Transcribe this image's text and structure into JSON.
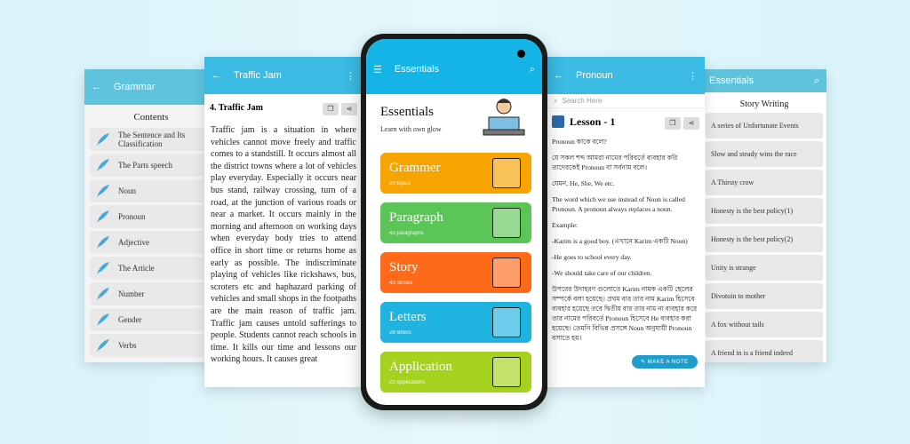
{
  "grammar_screen": {
    "title": "Grammar",
    "section": "Contents",
    "items": [
      "The Sentence and Its Classification",
      "The Parts speech",
      "Noun",
      "Pronoun",
      "Adjective",
      "The Article",
      "Number",
      "Gender",
      "Verbs"
    ]
  },
  "traffic_screen": {
    "title": "Traffic Jam",
    "heading": "4.  Traffic Jam",
    "body": "Traffic jam is a situation in where vehicles cannot move freely and traffic comes to a standstill. It occurs almost all the district towns where a lot of vehicles play everyday. Especially it occurs near bus stand, railway crossing, turn of a road, at the junction of various roads or near a market. It occurs mainly in the morning and afternoon on working days when everyday body tries to attend office in short time or returns home as early as possible. The indiscriminate playing of vehicles like rickshaws, bus, scroters etc and haphazard parking of vehicles and small shops in the footpaths are the main reason of traffic jam. Traffic jam causes untold sufferings to people. Students cannot reach schools in time. It kills our time and lessons our working hours. It causes great"
  },
  "main_screen": {
    "title": "Essentials",
    "header_title": "Essentials",
    "header_subtitle": "Learn with own glow",
    "cards": [
      {
        "label": "Grammer",
        "sub": "20 topics",
        "color": "#f7a400"
      },
      {
        "label": "Paragraph",
        "sub": "43 paragraphs",
        "color": "#5cc558"
      },
      {
        "label": "Story",
        "sub": "43 stories",
        "color": "#ff6a1a"
      },
      {
        "label": "Letters",
        "sub": "28 letters",
        "color": "#1fb4e0"
      },
      {
        "label": "Application",
        "sub": "22 Applications",
        "color": "#a5d21e"
      }
    ]
  },
  "pronoun_screen": {
    "title": "Pronoun",
    "search_placeholder": "Search Here",
    "lesson": "Lesson -  1",
    "lines": [
      "Pronoun কাকে বলে?",
      "যে সকল শব্দ আমরা নামের পরিবর্তে ব্যবহার করি তাদেরকেই Pronoun বা সর্বনাম বলে।",
      "যেমন, He, She, We etc.",
      "The word which we use instead of Noun is called Pronoun. A pronoun always replaces a noun.",
      "Example:",
      "-Karim is a good boy. (এখানে Karim একটি Noun)",
      "-He goes to school every day.",
      "-We should take care of our children.",
      "উপরের উদাহরণ গুলোতে Karim নামক একটি ছেলের সম্পর্কে বলা হয়েছে। প্রথম বার তার নাম Karim হিসেবে ব্যবহার হয়েছে তবে দ্বিতীয় বার তার নাম না ব্যবহার করে তার নামের পরিবর্তে Pronoun হিসেবে He ব্যবহার করা হয়েছে। তেমনি বিভিন্ন প্রসঙ্গে Noun অনুযায়ী Pronoun বসাতে হয়।"
    ],
    "fab": "MAKE A NOTE"
  },
  "story_screen": {
    "title": "Essentials",
    "section": "Story Writing",
    "items": [
      "A series of Unfortunate Events",
      "Slow and steady wins the race",
      "A Thirsty crow",
      "Honesty is the best policy(1)",
      "Honesty is the best policy(2)",
      "Unity is strange",
      "Divotoin to mother",
      "A fox without tails",
      "A friend in is a friend indeed"
    ]
  }
}
